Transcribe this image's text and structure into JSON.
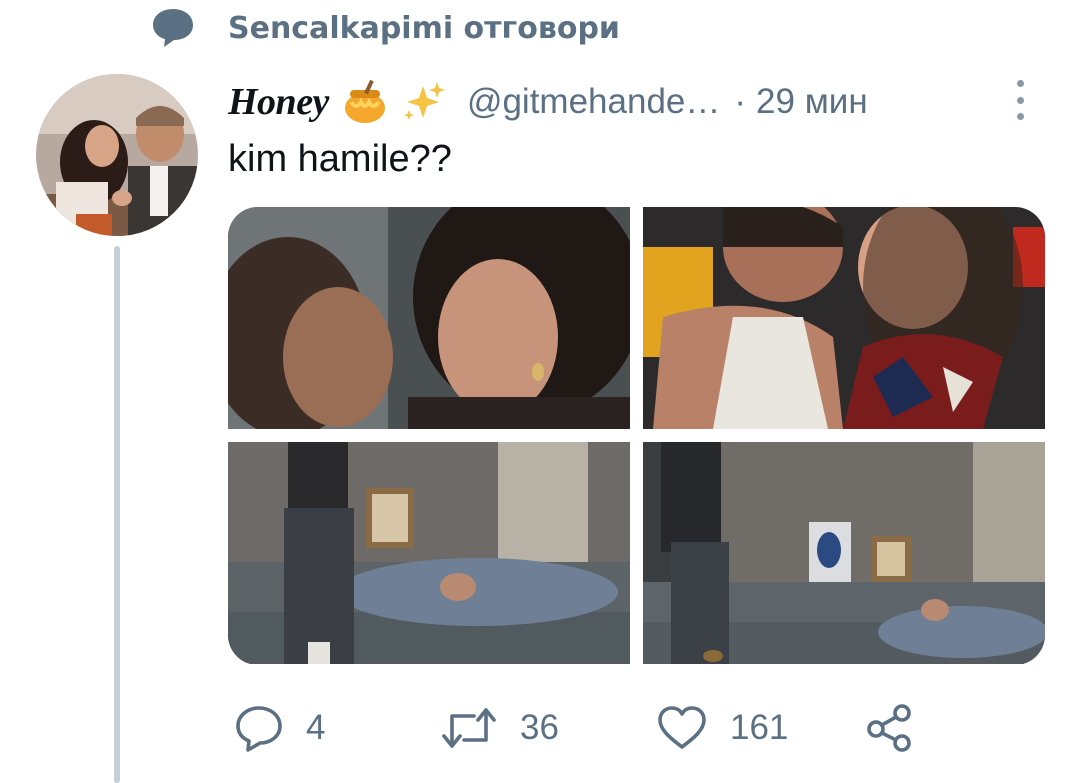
{
  "reply_context": {
    "icon": "speech-bubble-icon",
    "text": "Sencalkapimi отговори"
  },
  "tweet": {
    "display_name": "Honey",
    "name_emojis": [
      "honey-pot-icon",
      "sparkles-icon"
    ],
    "handle": "@gitmehande…",
    "separator": "·",
    "time": "29 мин",
    "text": "kim hamile??",
    "media": [
      {
        "name": "media-photo-1",
        "description": "close-up embrace"
      },
      {
        "name": "media-photo-2",
        "description": "kiss in tank top"
      },
      {
        "name": "media-photo-3",
        "description": "man beside sleeping woman on sofa"
      },
      {
        "name": "media-photo-4",
        "description": "man walking past sleeping woman"
      }
    ],
    "actions": {
      "reply_count": "4",
      "retweet_count": "36",
      "like_count": "161"
    }
  },
  "colors": {
    "secondary_text": "#5b7083",
    "thread_line": "#c4cfd6"
  }
}
